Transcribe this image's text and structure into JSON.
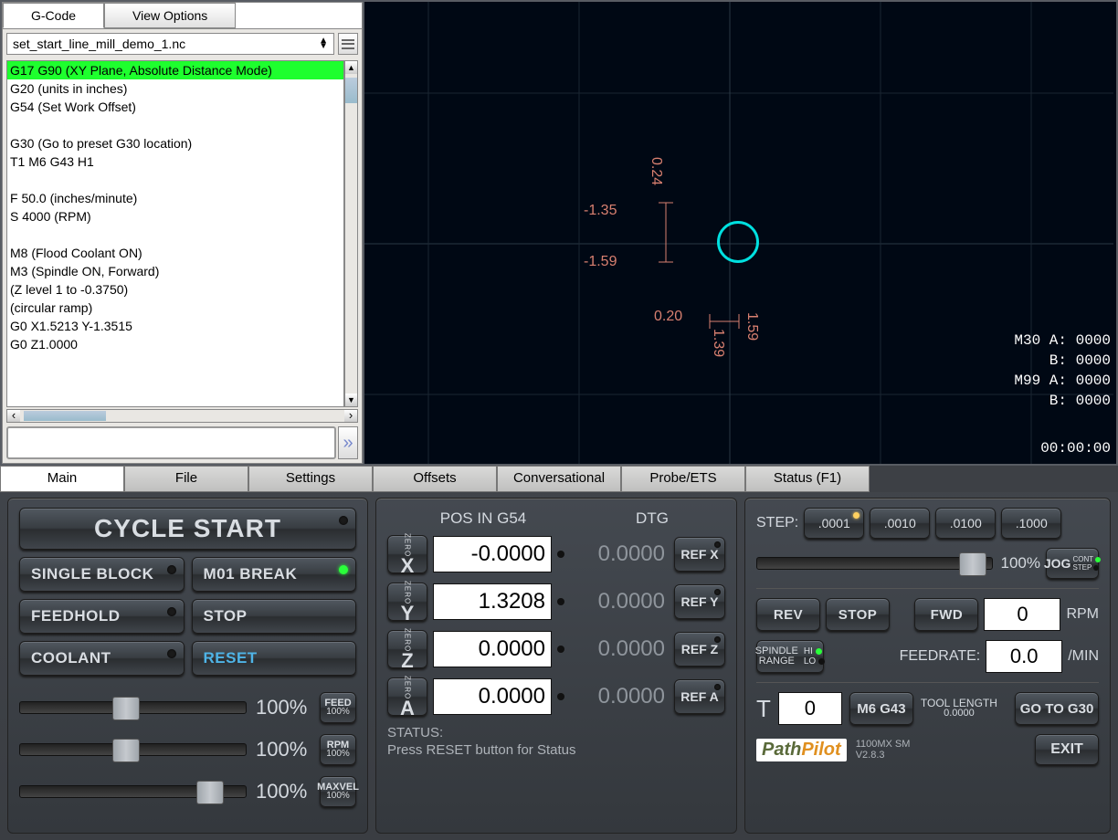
{
  "tabs_top": {
    "gcode": "G-Code",
    "view": "View Options"
  },
  "file": {
    "name": "set_start_line_mill_demo_1.nc"
  },
  "code": [
    "G17 G90  (XY Plane, Absolute Distance Mode)",
    "G20 (units in inches)",
    "G54 (Set Work Offset)",
    "",
    "G30 (Go to preset G30 location)",
    "T1 M6 G43 H1",
    "",
    "F 50.0 (inches/minute)",
    "S 4000 (RPM)",
    "",
    "M8 (Flood Coolant ON)",
    "M3 (Spindle ON, Forward)",
    "(Z level 1 to -0.3750)",
    "(circular ramp)",
    "G0 X1.5213 Y-1.3515",
    "G0 Z1.0000"
  ],
  "viewport": {
    "dims": {
      "a": "0.24",
      "b": "-1.35",
      "c": "-1.59",
      "d": "0.20",
      "e": "1.39",
      "f": "1.59"
    },
    "stats": [
      "M30 A: 0000",
      "B: 0000",
      "M99 A: 0000",
      "B: 0000"
    ],
    "time": "00:00:00"
  },
  "main_tabs": [
    "Main",
    "File",
    "Settings",
    "Offsets",
    "Conversational",
    "Probe/ETS",
    "Status (F1)"
  ],
  "left": {
    "cycle": "CYCLE START",
    "b1": "SINGLE BLOCK",
    "b2": "M01 BREAK",
    "b3": "FEEDHOLD",
    "b4": "STOP",
    "b5": "COOLANT",
    "b6": "RESET",
    "p1": "100%",
    "p2": "100%",
    "p3": "100%",
    "o1a": "FEED",
    "o1b": "100%",
    "o2a": "RPM",
    "o2b": "100%",
    "o3a": "MAXVEL",
    "o3b": "100%"
  },
  "mid": {
    "h1": "POS IN G54",
    "h2": "DTG",
    "axes": [
      {
        "name": "X",
        "pos": "-0.0000",
        "dtg": "0.0000",
        "ref": "REF X"
      },
      {
        "name": "Y",
        "pos": "1.3208",
        "dtg": "0.0000",
        "ref": "REF Y"
      },
      {
        "name": "Z",
        "pos": "0.0000",
        "dtg": "0.0000",
        "ref": "REF Z"
      },
      {
        "name": "A",
        "pos": "0.0000",
        "dtg": "0.0000",
        "ref": "REF A"
      }
    ],
    "zero": "ZERO",
    "status_l": "STATUS:",
    "status_t": "Press RESET button for Status"
  },
  "right": {
    "step_l": "STEP:",
    "steps": [
      ".0001",
      ".0010",
      ".0100",
      ".1000"
    ],
    "jog_pct": "100%",
    "jog": "JOG",
    "jog_cont": "CONT",
    "jog_step": "STEP",
    "rev": "REV",
    "stop": "STOP",
    "fwd": "FWD",
    "rpm_v": "0",
    "rpm_l": "RPM",
    "sr": "SPINDLE RANGE",
    "hi": "HI",
    "lo": "LO",
    "feed_l": "FEEDRATE:",
    "feed_v": "0.0",
    "feed_u": "/MIN",
    "t": "T",
    "t_v": "0",
    "m6": "M6 G43",
    "tl_l": "TOOL LENGTH",
    "tl_v": "0.0000",
    "g30": "GO TO G30",
    "brand1": "Path",
    "brand2": "Pilot",
    "ver1": "1100MX SM",
    "ver2": "V2.8.3",
    "exit": "EXIT"
  }
}
